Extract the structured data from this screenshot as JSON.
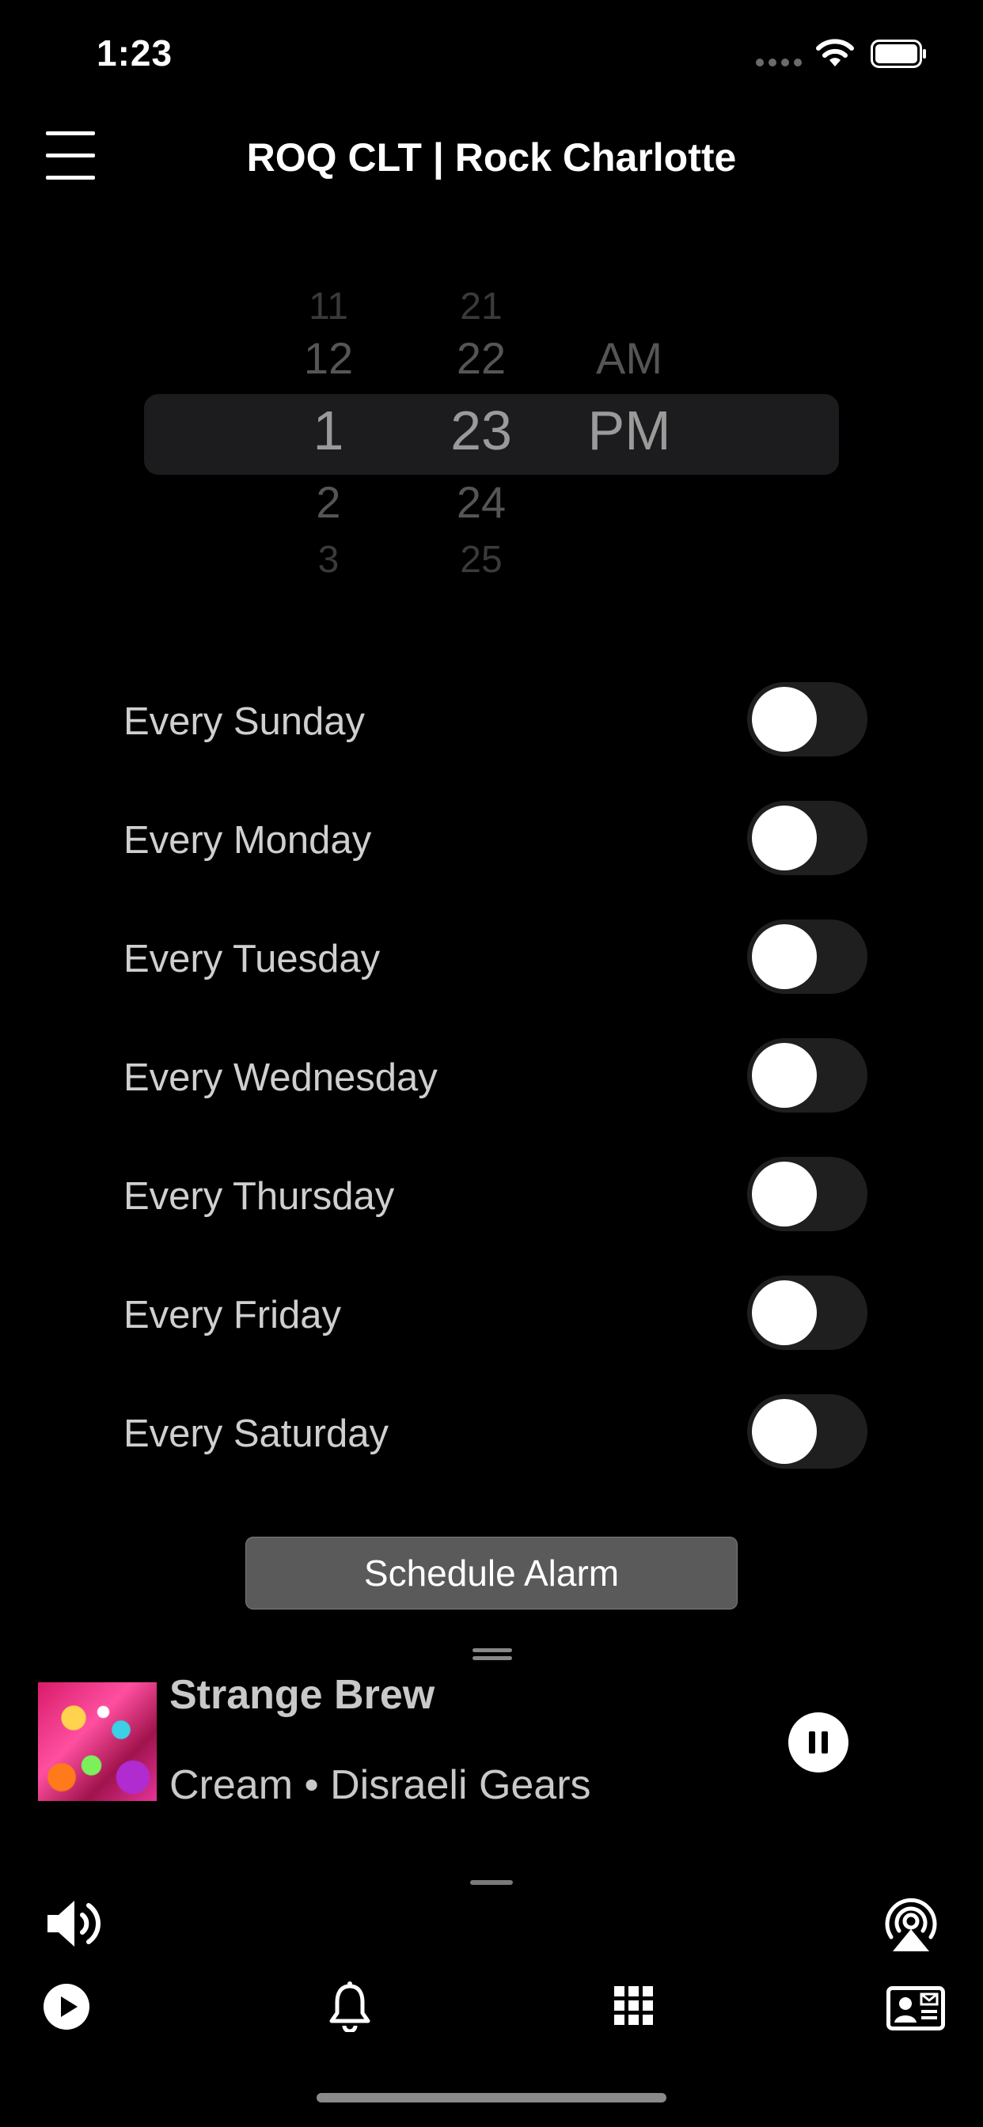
{
  "status_bar": {
    "time": "1:23"
  },
  "header": {
    "title": "ROQ CLT | Rock Charlotte"
  },
  "time_picker": {
    "hours": {
      "far_above": "11",
      "above": "12",
      "selected": "1",
      "below": "2",
      "far_below": "3"
    },
    "minutes": {
      "far_above": "21",
      "above": "22",
      "selected": "23",
      "below": "24",
      "far_below": "25"
    },
    "period": {
      "above": "AM",
      "selected": "PM"
    }
  },
  "repeat_days": [
    {
      "label": "Every Sunday",
      "on": false
    },
    {
      "label": "Every Monday",
      "on": false
    },
    {
      "label": "Every Tuesday",
      "on": false
    },
    {
      "label": "Every Wednesday",
      "on": false
    },
    {
      "label": "Every Thursday",
      "on": false
    },
    {
      "label": "Every Friday",
      "on": false
    },
    {
      "label": "Every Saturday",
      "on": false
    }
  ],
  "schedule_button": {
    "label": "Schedule Alarm"
  },
  "now_playing": {
    "title": "Strange Brew",
    "subtitle": "Cream • Disraeli Gears",
    "state": "playing"
  },
  "bottom_icons": [
    "volume-icon",
    "airplay-icon",
    "play-circle-icon",
    "bell-icon",
    "grid-icon",
    "contact-card-icon"
  ]
}
